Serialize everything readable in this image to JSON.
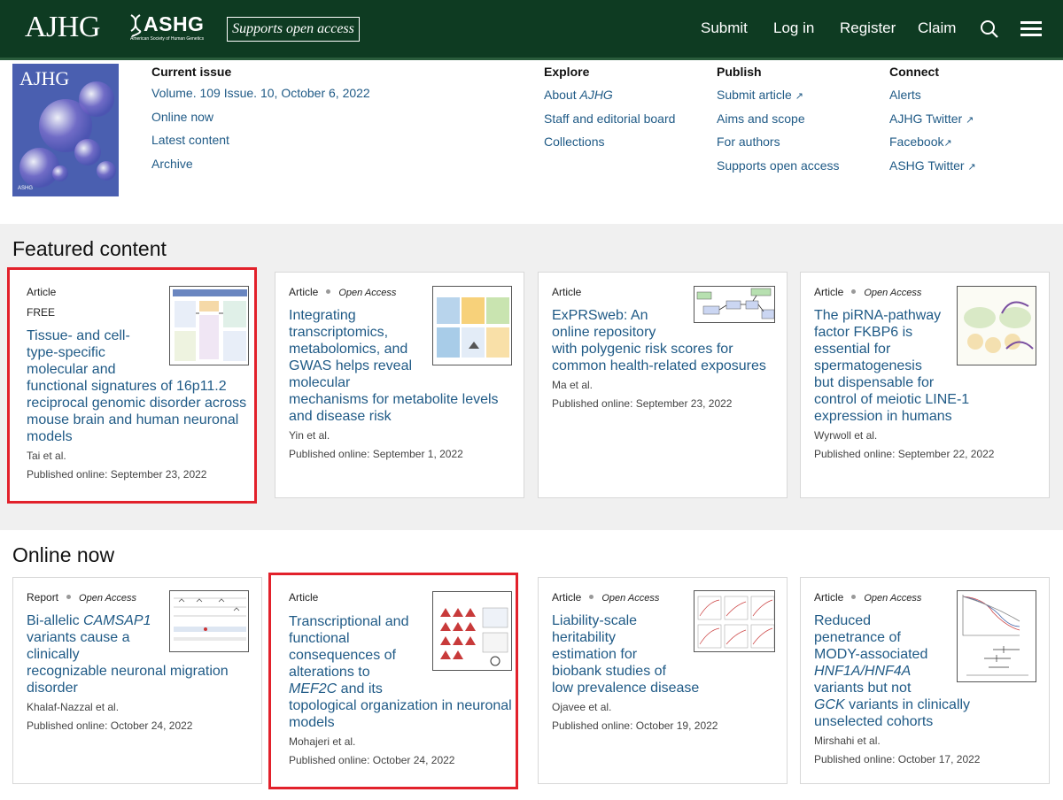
{
  "header": {
    "logo": "AJHG",
    "ashg_name": "ASHG",
    "ashg_sub": "American Society of Human Genetics",
    "open_access_badge": "Supports open access",
    "nav": [
      "Submit",
      "Log in",
      "Register",
      "Claim"
    ],
    "bg_color": "#0e3b22"
  },
  "cover": {
    "title": "AJHG",
    "footer": "ASHG"
  },
  "current_issue": {
    "heading": "Current issue",
    "volume": "Volume. 109 Issue. 10, October 6, 2022",
    "links": [
      "Online now",
      "Latest content",
      "Archive"
    ]
  },
  "explore": {
    "heading": "Explore",
    "about_prefix": "About ",
    "about_italic": "AJHG",
    "links": [
      "Staff and editorial board",
      "Collections"
    ]
  },
  "publish": {
    "heading": "Publish",
    "links": [
      "Submit article",
      "Aims and scope",
      "For authors",
      "Supports open access"
    ]
  },
  "connect": {
    "heading": "Connect",
    "links": [
      "Alerts",
      "AJHG Twitter",
      "Facebook",
      "ASHG Twitter"
    ]
  },
  "featured": {
    "heading": "Featured content",
    "cards": [
      {
        "type": "Article",
        "free": "FREE",
        "title_lines": [
          "Tissue- and cell-",
          "type-specific",
          "molecular and",
          "functional signatures of 16p11.2",
          "reciprocal genomic disorder across",
          "mouse brain and human neuronal",
          "models"
        ],
        "authors": "Tai et al.",
        "published": "Published online: September 23, 2022"
      },
      {
        "type": "Article",
        "access": "Open Access",
        "title_lines": [
          "Integrating",
          "transcriptomics,",
          "metabolomics, and",
          "GWAS helps reveal",
          "molecular",
          "mechanisms for metabolite levels",
          "and disease risk"
        ],
        "authors": "Yin et al.",
        "published": "Published online: September 1, 2022"
      },
      {
        "type": "Article",
        "title_lines": [
          "ExPRSweb: An",
          "online repository",
          "with polygenic risk scores for",
          "common health-related exposures"
        ],
        "authors": "Ma et al.",
        "published": "Published online: September 23, 2022"
      },
      {
        "type": "Article",
        "access": "Open Access",
        "title_lines": [
          "The piRNA-pathway",
          "factor FKBP6 is",
          "essential for",
          "spermatogenesis",
          "but dispensable for",
          "control of meiotic LINE-1",
          "expression in humans"
        ],
        "authors": "Wyrwoll et al.",
        "published": "Published online: September 22, 2022"
      }
    ]
  },
  "online_now": {
    "heading": "Online now",
    "cards": [
      {
        "type": "Report",
        "access": "Open Access",
        "title_l1_a": "Bi-allelic ",
        "title_l1_b": "CAMSAP1",
        "title_lines": [
          "variants cause a",
          "clinically",
          "recognizable neuronal migration",
          "disorder"
        ],
        "authors": "Khalaf-Nazzal et al.",
        "published": "Published online: October 24, 2022"
      },
      {
        "type": "Article",
        "title_lines": [
          "Transcriptional and",
          "functional",
          "consequences of",
          "alterations to"
        ],
        "title_l5_a": "MEF2C",
        "title_l5_b": " and its",
        "title_lines_b": [
          "topological organization in neuronal",
          "models"
        ],
        "authors": "Mohajeri et al.",
        "published": "Published online: October 24, 2022"
      },
      {
        "type": "Article",
        "access": "Open Access",
        "title_lines": [
          "Liability-scale",
          "heritability",
          "estimation for",
          "biobank studies of",
          "low prevalence disease"
        ],
        "authors": "Ojavee et al.",
        "published": "Published online: October 19, 2022"
      },
      {
        "type": "Article",
        "access": "Open Access",
        "title_lines": [
          "Reduced",
          "penetrance of",
          "MODY-associated"
        ],
        "title_l4": "HNF1A/HNF4A",
        "title_l5": "variants but not",
        "title_l6_a": "GCK",
        "title_l6_b": " variants in clinically",
        "title_l7": "unselected cohorts",
        "authors": "Mirshahi et al.",
        "published": "Published online: October 17, 2022"
      }
    ]
  }
}
